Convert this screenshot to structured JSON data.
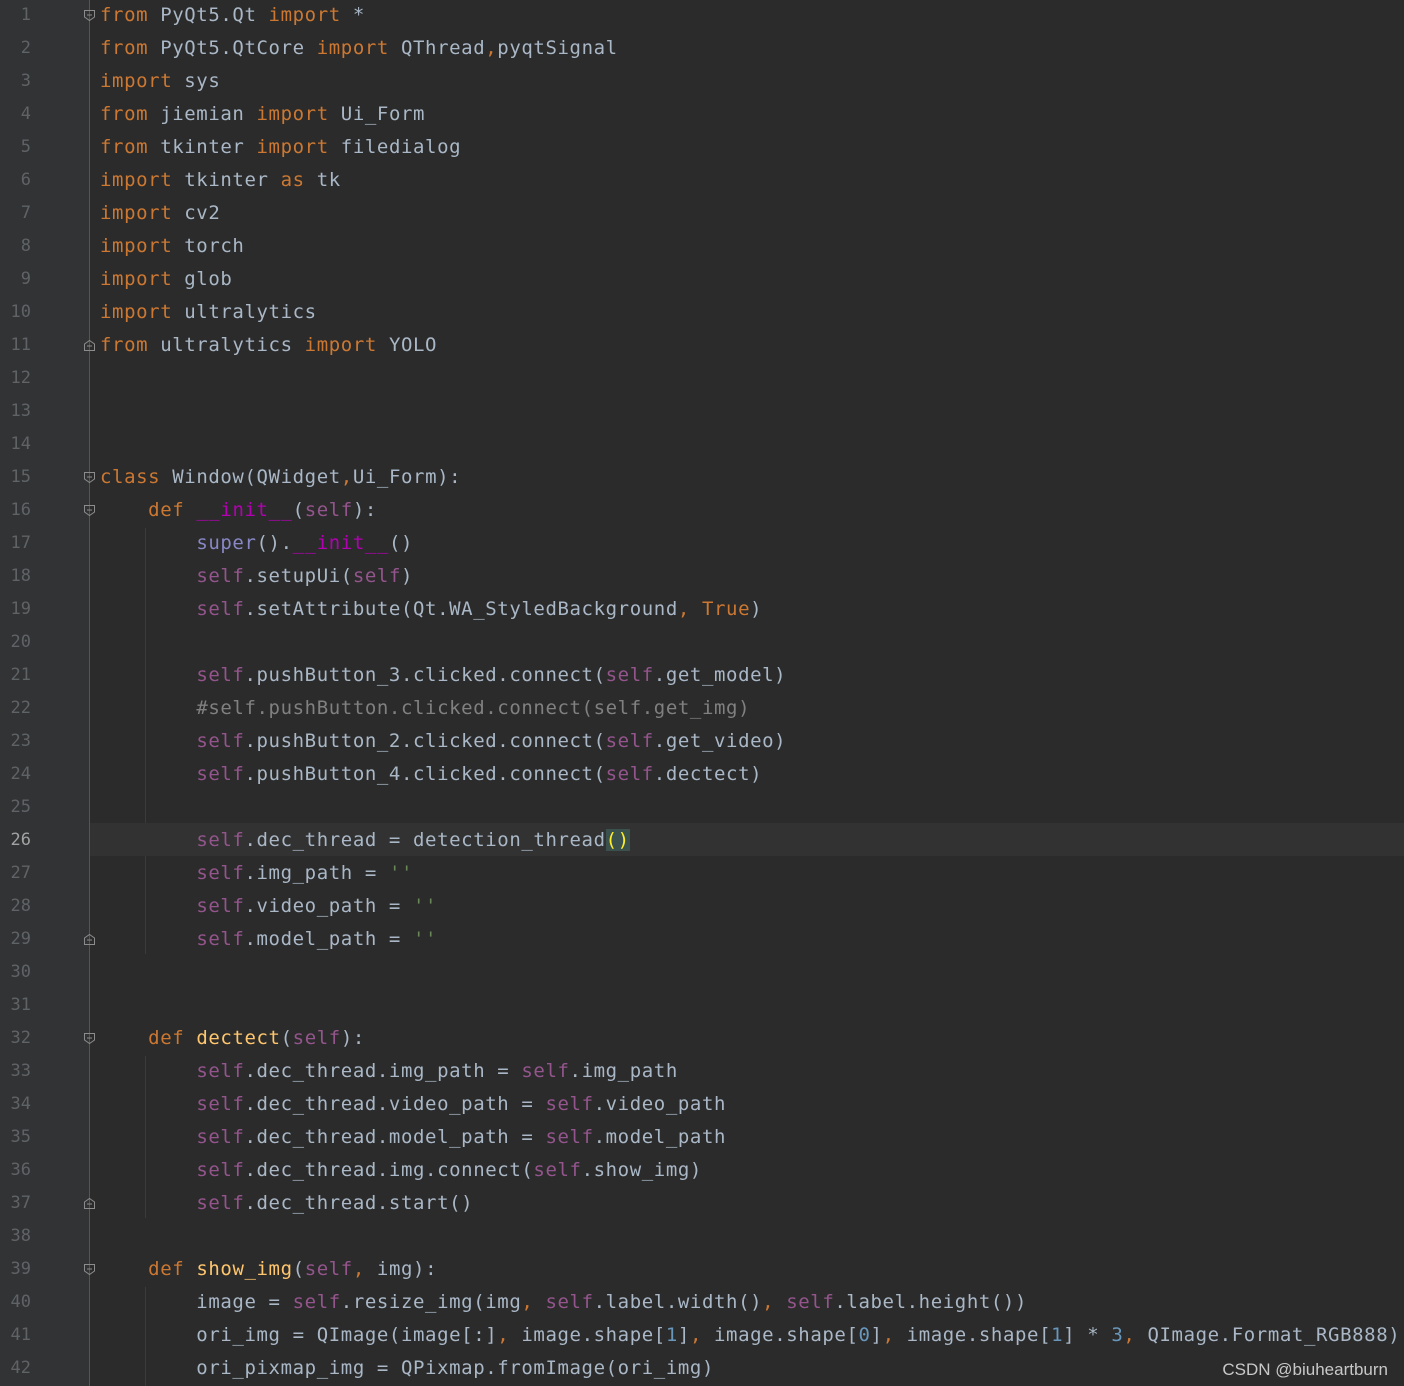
{
  "editor": {
    "current_line": 26,
    "lines": [
      {
        "n": "1",
        "tokens": [
          {
            "t": "from",
            "c": "kw"
          },
          {
            "t": " PyQt5.Qt ",
            "c": ""
          },
          {
            "t": "import",
            "c": "kw"
          },
          {
            "t": " *",
            "c": ""
          }
        ]
      },
      {
        "n": "2",
        "tokens": [
          {
            "t": "from",
            "c": "kw"
          },
          {
            "t": " PyQt5.QtCore ",
            "c": ""
          },
          {
            "t": "import",
            "c": "kw"
          },
          {
            "t": " QThread",
            "c": ""
          },
          {
            "t": ",",
            "c": "kw"
          },
          {
            "t": "pyqtSignal",
            "c": ""
          }
        ]
      },
      {
        "n": "3",
        "tokens": [
          {
            "t": "import",
            "c": "kw"
          },
          {
            "t": " sys",
            "c": ""
          }
        ]
      },
      {
        "n": "4",
        "tokens": [
          {
            "t": "from",
            "c": "kw"
          },
          {
            "t": " jiemian ",
            "c": ""
          },
          {
            "t": "import",
            "c": "kw"
          },
          {
            "t": " Ui_Form",
            "c": ""
          }
        ]
      },
      {
        "n": "5",
        "tokens": [
          {
            "t": "from",
            "c": "kw"
          },
          {
            "t": " tkinter ",
            "c": ""
          },
          {
            "t": "import",
            "c": "kw"
          },
          {
            "t": " filedialog",
            "c": ""
          }
        ]
      },
      {
        "n": "6",
        "tokens": [
          {
            "t": "import",
            "c": "kw"
          },
          {
            "t": " tkinter ",
            "c": ""
          },
          {
            "t": "as",
            "c": "kw"
          },
          {
            "t": " tk",
            "c": ""
          }
        ]
      },
      {
        "n": "7",
        "tokens": [
          {
            "t": "import",
            "c": "kw"
          },
          {
            "t": " cv2",
            "c": ""
          }
        ]
      },
      {
        "n": "8",
        "tokens": [
          {
            "t": "import",
            "c": "kw"
          },
          {
            "t": " torch",
            "c": ""
          }
        ]
      },
      {
        "n": "9",
        "tokens": [
          {
            "t": "import",
            "c": "kw"
          },
          {
            "t": " glob",
            "c": ""
          }
        ]
      },
      {
        "n": "10",
        "tokens": [
          {
            "t": "import",
            "c": "kw"
          },
          {
            "t": " ultralytics",
            "c": ""
          }
        ]
      },
      {
        "n": "11",
        "tokens": [
          {
            "t": "from",
            "c": "kw"
          },
          {
            "t": " ultralytics ",
            "c": ""
          },
          {
            "t": "import",
            "c": "kw"
          },
          {
            "t": " YOLO",
            "c": ""
          }
        ]
      },
      {
        "n": "12",
        "tokens": []
      },
      {
        "n": "13",
        "tokens": []
      },
      {
        "n": "14",
        "tokens": []
      },
      {
        "n": "15",
        "tokens": [
          {
            "t": "class",
            "c": "kw"
          },
          {
            "t": " Window(QWidget",
            "c": ""
          },
          {
            "t": ",",
            "c": "kw"
          },
          {
            "t": "Ui_Form):",
            "c": ""
          }
        ]
      },
      {
        "n": "16",
        "tokens": [
          {
            "t": "    ",
            "c": ""
          },
          {
            "t": "def",
            "c": "kw"
          },
          {
            "t": " ",
            "c": ""
          },
          {
            "t": "__init__",
            "c": "mg"
          },
          {
            "t": "(",
            "c": ""
          },
          {
            "t": "self",
            "c": "sf"
          },
          {
            "t": "):",
            "c": ""
          }
        ]
      },
      {
        "n": "17",
        "tokens": [
          {
            "t": "        ",
            "c": ""
          },
          {
            "t": "super",
            "c": "bi"
          },
          {
            "t": "().",
            "c": ""
          },
          {
            "t": "__init__",
            "c": "mg"
          },
          {
            "t": "()",
            "c": ""
          }
        ]
      },
      {
        "n": "18",
        "tokens": [
          {
            "t": "        ",
            "c": ""
          },
          {
            "t": "self",
            "c": "sf"
          },
          {
            "t": ".setupUi(",
            "c": ""
          },
          {
            "t": "self",
            "c": "sf"
          },
          {
            "t": ")",
            "c": ""
          }
        ]
      },
      {
        "n": "19",
        "tokens": [
          {
            "t": "        ",
            "c": ""
          },
          {
            "t": "self",
            "c": "sf"
          },
          {
            "t": ".setAttribute(Qt.WA_StyledBackground",
            "c": ""
          },
          {
            "t": ", ",
            "c": "kw"
          },
          {
            "t": "True",
            "c": "kw"
          },
          {
            "t": ")",
            "c": ""
          }
        ]
      },
      {
        "n": "20",
        "tokens": []
      },
      {
        "n": "21",
        "tokens": [
          {
            "t": "        ",
            "c": ""
          },
          {
            "t": "self",
            "c": "sf"
          },
          {
            "t": ".pushButton_3.clicked.connect(",
            "c": ""
          },
          {
            "t": "self",
            "c": "sf"
          },
          {
            "t": ".get_model)",
            "c": ""
          }
        ]
      },
      {
        "n": "22",
        "tokens": [
          {
            "t": "        ",
            "c": ""
          },
          {
            "t": "#self.pushButton.clicked.connect(self.get_img)",
            "c": "cm"
          }
        ]
      },
      {
        "n": "23",
        "tokens": [
          {
            "t": "        ",
            "c": ""
          },
          {
            "t": "self",
            "c": "sf"
          },
          {
            "t": ".pushButton_2.clicked.connect(",
            "c": ""
          },
          {
            "t": "self",
            "c": "sf"
          },
          {
            "t": ".get_video)",
            "c": ""
          }
        ]
      },
      {
        "n": "24",
        "tokens": [
          {
            "t": "        ",
            "c": ""
          },
          {
            "t": "self",
            "c": "sf"
          },
          {
            "t": ".pushButton_4.clicked.connect(",
            "c": ""
          },
          {
            "t": "self",
            "c": "sf"
          },
          {
            "t": ".dectect)",
            "c": ""
          }
        ]
      },
      {
        "n": "25",
        "tokens": []
      },
      {
        "n": "26",
        "tokens": [
          {
            "t": "        ",
            "c": ""
          },
          {
            "t": "self",
            "c": "sf"
          },
          {
            "t": ".dec_thread = detection_thread",
            "c": ""
          },
          {
            "t": "()",
            "c": "br"
          }
        ]
      },
      {
        "n": "27",
        "tokens": [
          {
            "t": "        ",
            "c": ""
          },
          {
            "t": "self",
            "c": "sf"
          },
          {
            "t": ".img_path = ",
            "c": ""
          },
          {
            "t": "''",
            "c": "st"
          }
        ]
      },
      {
        "n": "28",
        "tokens": [
          {
            "t": "        ",
            "c": ""
          },
          {
            "t": "self",
            "c": "sf"
          },
          {
            "t": ".video_path = ",
            "c": ""
          },
          {
            "t": "''",
            "c": "st"
          }
        ]
      },
      {
        "n": "29",
        "tokens": [
          {
            "t": "        ",
            "c": ""
          },
          {
            "t": "self",
            "c": "sf"
          },
          {
            "t": ".model_path = ",
            "c": ""
          },
          {
            "t": "''",
            "c": "st"
          }
        ]
      },
      {
        "n": "30",
        "tokens": []
      },
      {
        "n": "31",
        "tokens": []
      },
      {
        "n": "32",
        "tokens": [
          {
            "t": "    ",
            "c": ""
          },
          {
            "t": "def",
            "c": "kw"
          },
          {
            "t": " ",
            "c": ""
          },
          {
            "t": "dectect",
            "c": "fn"
          },
          {
            "t": "(",
            "c": ""
          },
          {
            "t": "self",
            "c": "sf"
          },
          {
            "t": "):",
            "c": ""
          }
        ]
      },
      {
        "n": "33",
        "tokens": [
          {
            "t": "        ",
            "c": ""
          },
          {
            "t": "self",
            "c": "sf"
          },
          {
            "t": ".dec_thread.img_path = ",
            "c": ""
          },
          {
            "t": "self",
            "c": "sf"
          },
          {
            "t": ".img_path",
            "c": ""
          }
        ]
      },
      {
        "n": "34",
        "tokens": [
          {
            "t": "        ",
            "c": ""
          },
          {
            "t": "self",
            "c": "sf"
          },
          {
            "t": ".dec_thread.video_path = ",
            "c": ""
          },
          {
            "t": "self",
            "c": "sf"
          },
          {
            "t": ".video_path",
            "c": ""
          }
        ]
      },
      {
        "n": "35",
        "tokens": [
          {
            "t": "        ",
            "c": ""
          },
          {
            "t": "self",
            "c": "sf"
          },
          {
            "t": ".dec_thread.model_path = ",
            "c": ""
          },
          {
            "t": "self",
            "c": "sf"
          },
          {
            "t": ".model_path",
            "c": ""
          }
        ]
      },
      {
        "n": "36",
        "tokens": [
          {
            "t": "        ",
            "c": ""
          },
          {
            "t": "self",
            "c": "sf"
          },
          {
            "t": ".dec_thread.img.connect(",
            "c": ""
          },
          {
            "t": "self",
            "c": "sf"
          },
          {
            "t": ".show_img)",
            "c": ""
          }
        ]
      },
      {
        "n": "37",
        "tokens": [
          {
            "t": "        ",
            "c": ""
          },
          {
            "t": "self",
            "c": "sf"
          },
          {
            "t": ".dec_thread.start()",
            "c": ""
          }
        ]
      },
      {
        "n": "38",
        "tokens": []
      },
      {
        "n": "39",
        "tokens": [
          {
            "t": "    ",
            "c": ""
          },
          {
            "t": "def",
            "c": "kw"
          },
          {
            "t": " ",
            "c": ""
          },
          {
            "t": "show_img",
            "c": "fn"
          },
          {
            "t": "(",
            "c": ""
          },
          {
            "t": "self",
            "c": "sf"
          },
          {
            "t": ", ",
            "c": "kw"
          },
          {
            "t": "img):",
            "c": ""
          }
        ]
      },
      {
        "n": "40",
        "tokens": [
          {
            "t": "        image = ",
            "c": ""
          },
          {
            "t": "self",
            "c": "sf"
          },
          {
            "t": ".resize_img(img",
            "c": ""
          },
          {
            "t": ", ",
            "c": "kw"
          },
          {
            "t": "self",
            "c": "sf"
          },
          {
            "t": ".label.width()",
            "c": ""
          },
          {
            "t": ", ",
            "c": "kw"
          },
          {
            "t": "self",
            "c": "sf"
          },
          {
            "t": ".label.height())",
            "c": ""
          }
        ]
      },
      {
        "n": "41",
        "tokens": [
          {
            "t": "        ori_img = QImage(image[:]",
            "c": ""
          },
          {
            "t": ", ",
            "c": "kw"
          },
          {
            "t": "image.shape[",
            "c": ""
          },
          {
            "t": "1",
            "c": "num"
          },
          {
            "t": "]",
            "c": ""
          },
          {
            "t": ", ",
            "c": "kw"
          },
          {
            "t": "image.shape[",
            "c": ""
          },
          {
            "t": "0",
            "c": "num"
          },
          {
            "t": "]",
            "c": ""
          },
          {
            "t": ", ",
            "c": "kw"
          },
          {
            "t": "image.shape[",
            "c": ""
          },
          {
            "t": "1",
            "c": "num"
          },
          {
            "t": "] * ",
            "c": ""
          },
          {
            "t": "3",
            "c": "num"
          },
          {
            "t": ", ",
            "c": "kw"
          },
          {
            "t": "QImage.Format_RGB888)",
            "c": ""
          }
        ]
      },
      {
        "n": "42",
        "tokens": [
          {
            "t": "        ori_pixmap_img = QPixmap.fromImage(ori_img)",
            "c": ""
          }
        ]
      }
    ]
  },
  "watermark": "CSDN @biuheartburn"
}
